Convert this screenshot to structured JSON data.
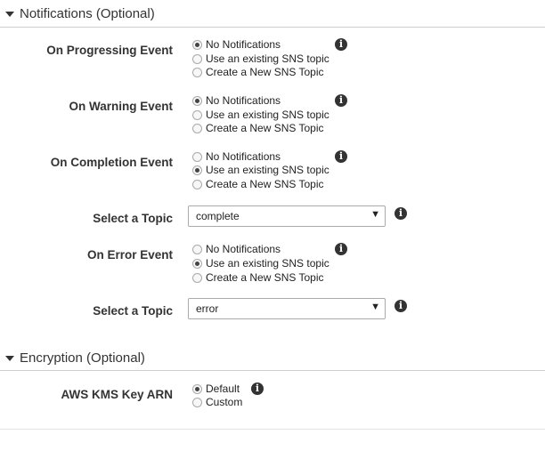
{
  "notifications": {
    "header": "Notifications (Optional)",
    "events": [
      {
        "label": "On Progressing Event",
        "options": [
          "No Notifications",
          "Use an existing SNS topic",
          "Create a New SNS Topic"
        ],
        "selected_option": "No Notifications"
      },
      {
        "label": "On Warning Event",
        "options": [
          "No Notifications",
          "Use an existing SNS topic",
          "Create a New SNS Topic"
        ],
        "selected_option": "No Notifications"
      },
      {
        "label": "On Completion Event",
        "options": [
          "No Notifications",
          "Use an existing SNS topic",
          "Create a New SNS Topic"
        ],
        "selected_option": "Use an existing SNS topic",
        "topic_label": "Select a Topic",
        "topic_value": "complete"
      },
      {
        "label": "On Error Event",
        "options": [
          "No Notifications",
          "Use an existing SNS topic",
          "Create a New SNS Topic"
        ],
        "selected_option": "Use an existing SNS topic",
        "topic_label": "Select a Topic",
        "topic_value": "error"
      }
    ]
  },
  "encryption": {
    "header": "Encryption (Optional)",
    "kms": {
      "label": "AWS KMS Key ARN",
      "options": [
        "Default",
        "Custom"
      ],
      "selected_option": "Default"
    }
  },
  "icons": {
    "info": "i",
    "caret": "caret-down-icon",
    "select_arrow": "▼"
  },
  "colors": {
    "text": "#333333",
    "divider": "#cfcfcf",
    "info_icon": "#333333"
  }
}
